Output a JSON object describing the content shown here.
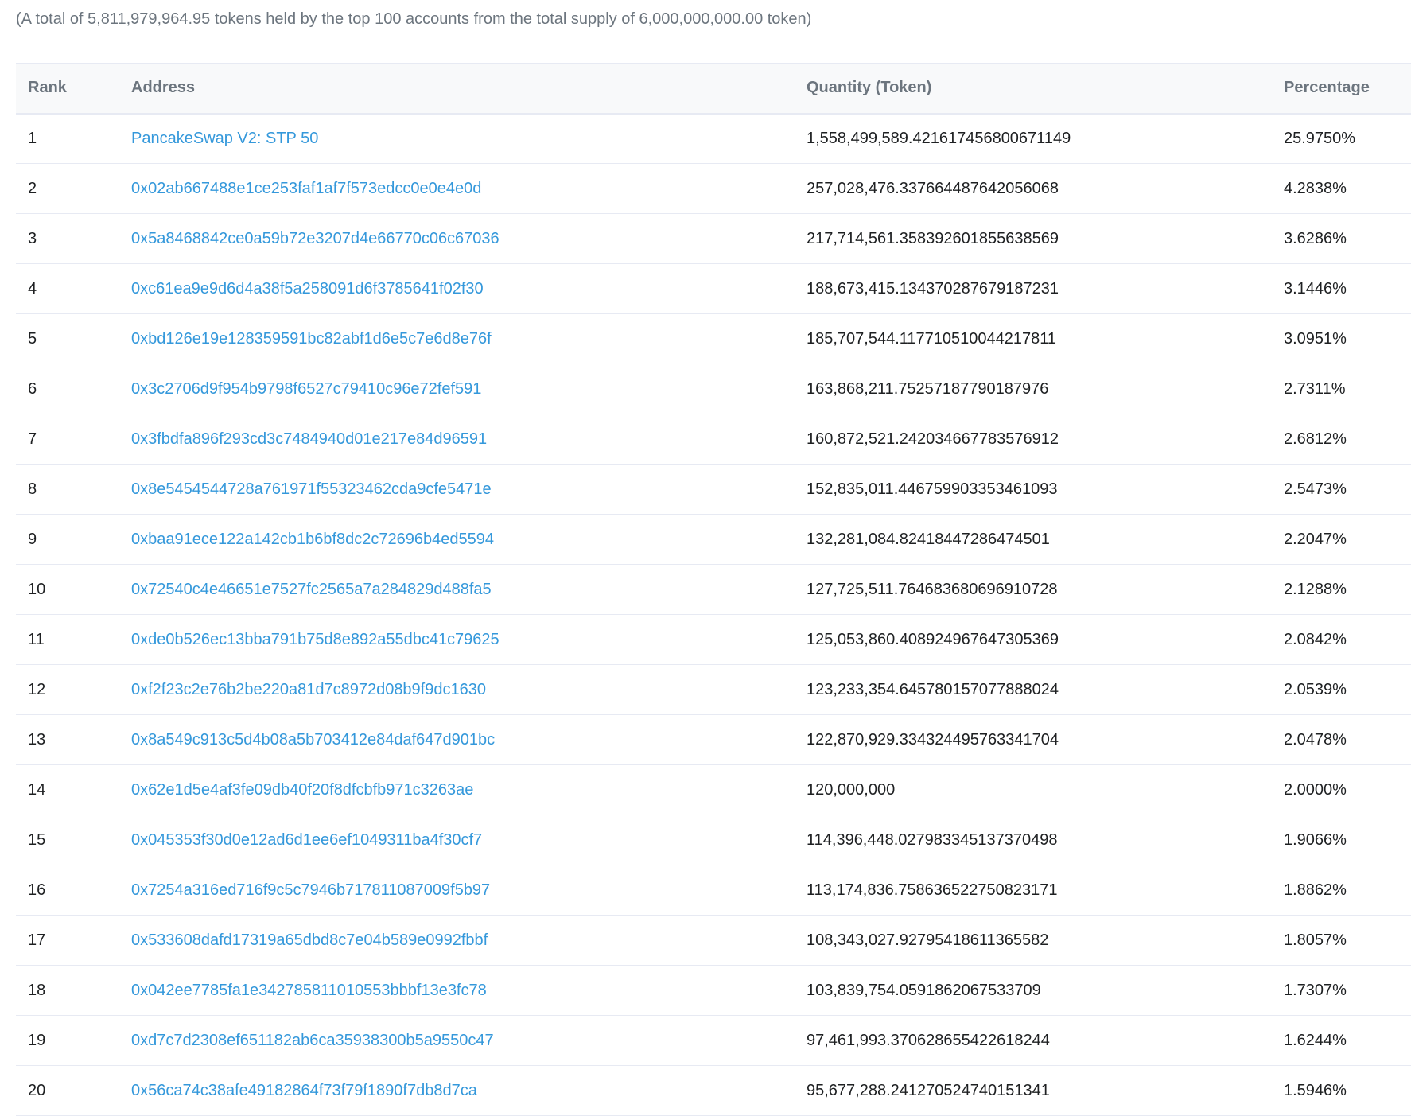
{
  "summary": "(A total of 5,811,979,964.95 tokens held by the top 100 accounts from the total supply of 6,000,000,000.00 token)",
  "table": {
    "headers": {
      "rank": "Rank",
      "address": "Address",
      "quantity": "Quantity (Token)",
      "percentage": "Percentage"
    },
    "rows": [
      {
        "rank": "1",
        "address": "PancakeSwap V2: STP 50",
        "quantity": "1,558,499,589.421617456800671149",
        "percentage": "25.9750%"
      },
      {
        "rank": "2",
        "address": "0x02ab667488e1ce253faf1af7f573edcc0e0e4e0d",
        "quantity": "257,028,476.337664487642056068",
        "percentage": "4.2838%"
      },
      {
        "rank": "3",
        "address": "0x5a8468842ce0a59b72e3207d4e66770c06c67036",
        "quantity": "217,714,561.358392601855638569",
        "percentage": "3.6286%"
      },
      {
        "rank": "4",
        "address": "0xc61ea9e9d6d4a38f5a258091d6f3785641f02f30",
        "quantity": "188,673,415.134370287679187231",
        "percentage": "3.1446%"
      },
      {
        "rank": "5",
        "address": "0xbd126e19e128359591bc82abf1d6e5c7e6d8e76f",
        "quantity": "185,707,544.117710510044217811",
        "percentage": "3.0951%"
      },
      {
        "rank": "6",
        "address": "0x3c2706d9f954b9798f6527c79410c96e72fef591",
        "quantity": "163,868,211.75257187790187976",
        "percentage": "2.7311%"
      },
      {
        "rank": "7",
        "address": "0x3fbdfa896f293cd3c7484940d01e217e84d96591",
        "quantity": "160,872,521.242034667783576912",
        "percentage": "2.6812%"
      },
      {
        "rank": "8",
        "address": "0x8e5454544728a761971f55323462cda9cfe5471e",
        "quantity": "152,835,011.446759903353461093",
        "percentage": "2.5473%"
      },
      {
        "rank": "9",
        "address": "0xbaa91ece122a142cb1b6bf8dc2c72696b4ed5594",
        "quantity": "132,281,084.82418447286474501",
        "percentage": "2.2047%"
      },
      {
        "rank": "10",
        "address": "0x72540c4e46651e7527fc2565a7a284829d488fa5",
        "quantity": "127,725,511.764683680696910728",
        "percentage": "2.1288%"
      },
      {
        "rank": "11",
        "address": "0xde0b526ec13bba791b75d8e892a55dbc41c79625",
        "quantity": "125,053,860.408924967647305369",
        "percentage": "2.0842%"
      },
      {
        "rank": "12",
        "address": "0xf2f23c2e76b2be220a81d7c8972d08b9f9dc1630",
        "quantity": "123,233,354.645780157077888024",
        "percentage": "2.0539%"
      },
      {
        "rank": "13",
        "address": "0x8a549c913c5d4b08a5b703412e84daf647d901bc",
        "quantity": "122,870,929.334324495763341704",
        "percentage": "2.0478%"
      },
      {
        "rank": "14",
        "address": "0x62e1d5e4af3fe09db40f20f8dfcbfb971c3263ae",
        "quantity": "120,000,000",
        "percentage": "2.0000%"
      },
      {
        "rank": "15",
        "address": "0x045353f30d0e12ad6d1ee6ef1049311ba4f30cf7",
        "quantity": "114,396,448.027983345137370498",
        "percentage": "1.9066%"
      },
      {
        "rank": "16",
        "address": "0x7254a316ed716f9c5c7946b717811087009f5b97",
        "quantity": "113,174,836.758636522750823171",
        "percentage": "1.8862%"
      },
      {
        "rank": "17",
        "address": "0x533608dafd17319a65dbd8c7e04b589e0992fbbf",
        "quantity": "108,343,027.92795418611365582",
        "percentage": "1.8057%"
      },
      {
        "rank": "18",
        "address": "0x042ee7785fa1e342785811010553bbbf13e3fc78",
        "quantity": "103,839,754.0591862067533709",
        "percentage": "1.7307%"
      },
      {
        "rank": "19",
        "address": "0xd7c7d2308ef651182ab6ca35938300b5a9550c47",
        "quantity": "97,461,993.370628655422618244",
        "percentage": "1.6244%"
      },
      {
        "rank": "20",
        "address": "0x56ca74c38afe49182864f73f79f1890f7db8d7ca",
        "quantity": "95,677,288.241270524740151341",
        "percentage": "1.5946%"
      }
    ]
  },
  "colors": {
    "link": "#3498db",
    "muted_text": "#6c757e",
    "body_text": "#1e2022",
    "header_bg": "#f8f9fa",
    "border": "#e7eaf3"
  }
}
